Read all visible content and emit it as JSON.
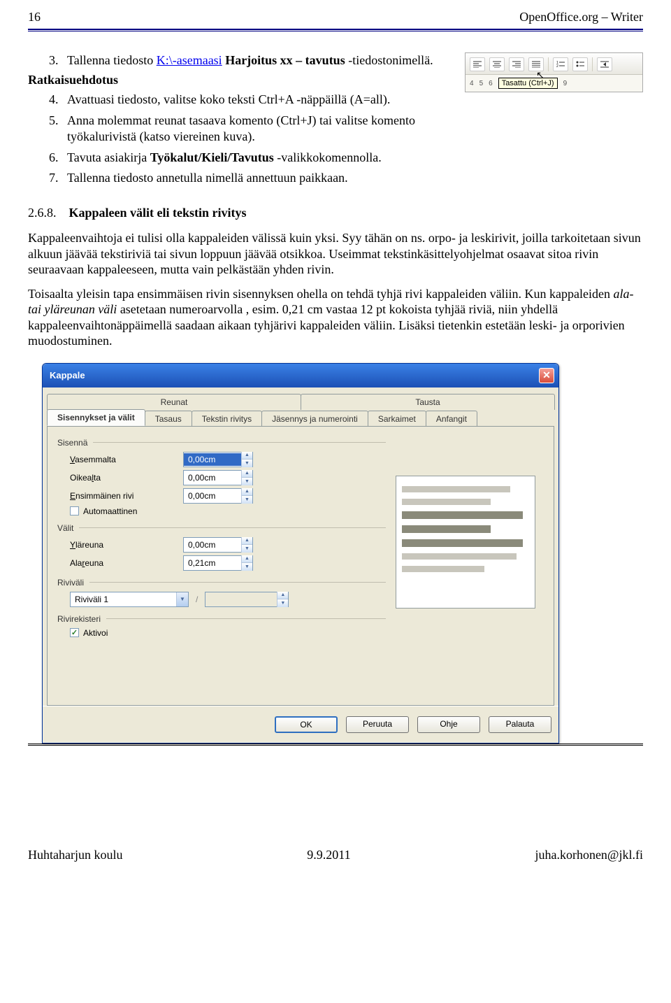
{
  "header": {
    "left": "16",
    "right": "OpenOffice.org – Writer"
  },
  "task3": {
    "num": "3.",
    "prefix": "Tallenna tiedosto ",
    "link": "K:\\-asemaasi",
    "mid": "  ",
    "bold": "Harjoitus xx – tavutus",
    "suffix": " -tiedostonimellä."
  },
  "solution_title": "Ratkaisuehdotus",
  "task4": {
    "num": "4.",
    "text": "Avattuasi tiedosto, valitse koko teksti Ctrl+A  -näppäillä (A=all)."
  },
  "task5": {
    "num": "5.",
    "text": "Anna molemmat reunat tasaava komento (Ctrl+J) tai valitse komento työkalurivistä (katso viereinen kuva)."
  },
  "task6": {
    "num": "6.",
    "prefix": "Tavuta asiakirja ",
    "bold": "Työkalut/Kieli/Tavutus",
    "suffix": " -valikkokomennolla."
  },
  "task7": {
    "num": "7.",
    "text": "Tallenna tiedosto annetulla nimellä annettuun paikkaan."
  },
  "heading268": {
    "num": "2.6.8.",
    "title": "Kappaleen välit eli tekstin rivitys"
  },
  "para1": "Kappaleenvaihtoja ei tulisi olla kappaleiden välissä kuin yksi. Syy tähän on ns. orpo- ja leskirivit, joilla tarkoitetaan sivun alkuun jäävää tekstiriviä tai sivun loppuun jäävää otsikkoa. Useimmat tekstinkäsittelyohjelmat osaavat sitoa rivin seuraavaan kappaleeseen, mutta vain pelkästään yhden rivin.",
  "para2_a": "Toisaalta yleisin tapa ensimmäisen rivin sisennyksen ohella on tehdä tyhjä rivi kappaleiden väliin. Kun kappaleiden ",
  "para2_ital": "ala- tai yläreunan väli",
  "para2_b": " asetetaan numeroarvolla , esim. 0,21 cm vastaa 12 pt kokoista tyhjää riviä, niin yhdellä kappaleenvaihtonäppäimellä saadaan aikaan tyhjärivi kappaleiden väliin. Lisäksi tietenkin estetään leski- ja orporivien muodostuminen.",
  "toolbar": {
    "tooltip": "Tasattu (Ctrl+J)",
    "ruler": [
      "4",
      "5",
      "6",
      "9"
    ]
  },
  "dialog": {
    "title": "Kappale",
    "tabs_row1": [
      "Reunat",
      "Tausta"
    ],
    "tabs_row2": [
      "Sisennykset ja välit",
      "Tasaus",
      "Tekstin rivitys",
      "Jäsennys ja numerointi",
      "Sarkaimet",
      "Anfangit"
    ],
    "section_sisenna": "Sisennä",
    "lbl_vasemmalta": "Vasemmalta",
    "val_vasemmalta": "0,00cm",
    "lbl_oikealta": "Oikealta",
    "val_oikealta": "0,00cm",
    "lbl_ensrivi": "Ensimmäinen rivi",
    "val_ensrivi": "0,00cm",
    "lbl_auto": "Automaattinen",
    "section_valit": "Välit",
    "lbl_ylareuna": "Yläreuna",
    "val_ylareuna": "0,00cm",
    "lbl_alareuna": "Alareuna",
    "val_alareuna": "0,21cm",
    "section_rivivali": "Riviväli",
    "dd_rivivali": "Riviväli 1",
    "slash": "/",
    "section_rivirekisteri": "Rivirekisteri",
    "lbl_aktivoi": "Aktivoi",
    "btn_ok": "OK",
    "btn_peruuta": "Peruuta",
    "btn_ohje": "Ohje",
    "btn_palauta": "Palauta"
  },
  "footer": {
    "left": "Huhtaharjun koulu",
    "center": "9.9.2011",
    "right": "juha.korhonen@jkl.fi"
  }
}
